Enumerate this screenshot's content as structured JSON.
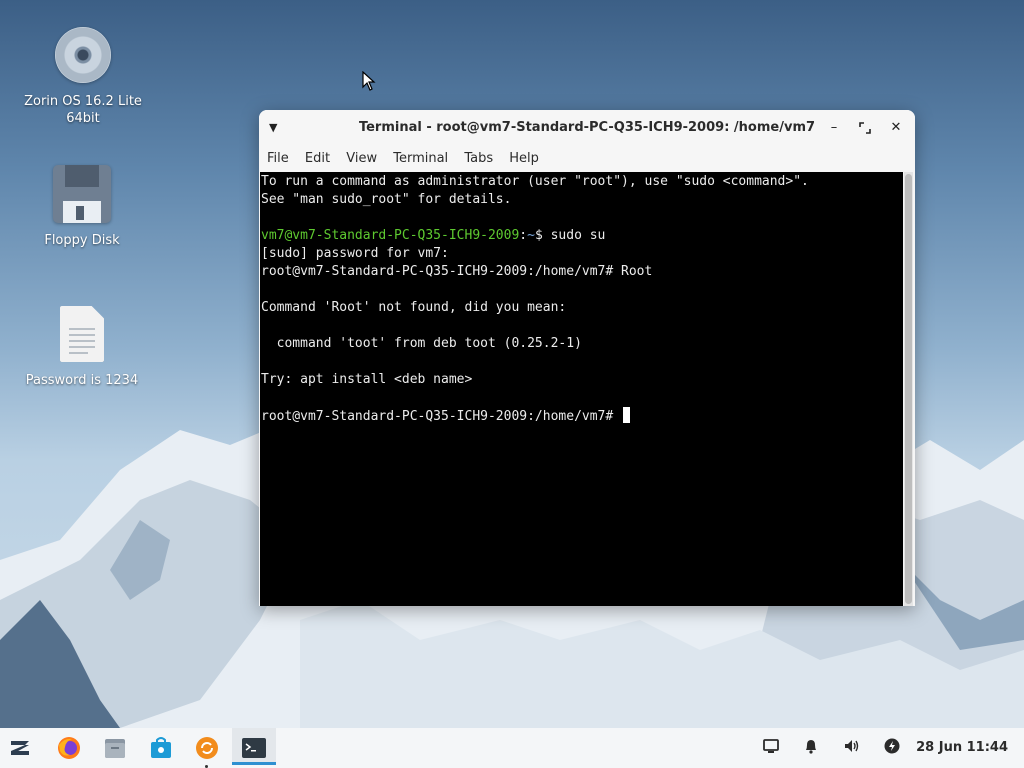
{
  "desktop": {
    "icons": [
      {
        "label": "Zorin OS 16.2 Lite 64bit",
        "icon": "disc-icon"
      },
      {
        "label": "Floppy Disk",
        "icon": "floppy-disk-icon"
      },
      {
        "label": "Password is 1234",
        "icon": "text-file-icon"
      }
    ]
  },
  "terminal": {
    "title": "Terminal - root@vm7-Standard-PC-Q35-ICH9-2009: /home/vm7",
    "menu": [
      "File",
      "Edit",
      "View",
      "Terminal",
      "Tabs",
      "Help"
    ],
    "lines": {
      "l1": "To run a command as administrator (user \"root\"), use \"sudo <command>\".",
      "l2": "See \"man sudo_root\" for details.",
      "prompt_user": "vm7@vm7-Standard-PC-Q35-ICH9-2009",
      "prompt_colon": ":",
      "prompt_path": "~",
      "prompt_cmd": "$ sudo su",
      "l4": "[sudo] password for vm7:",
      "l5": "root@vm7-Standard-PC-Q35-ICH9-2009:/home/vm7# Root",
      "l7": "Command 'Root' not found, did you mean:",
      "l9": "  command 'toot' from deb toot (0.25.2-1)",
      "l11": "Try: apt install <deb name>",
      "l13": "root@vm7-Standard-PC-Q35-ICH9-2009:/home/vm7# "
    }
  },
  "taskbar": {
    "apps": [
      "zorin-menu-icon",
      "firefox-icon",
      "files-icon",
      "software-store-icon",
      "update-icon",
      "terminal-icon"
    ],
    "tray": [
      "display-icon",
      "notification-bell-icon",
      "volume-icon",
      "power-icon"
    ],
    "clock": "28 Jun 11:44"
  }
}
